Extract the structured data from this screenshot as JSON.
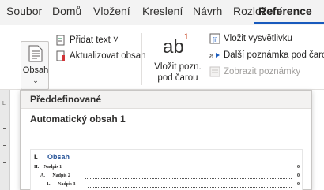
{
  "tabs": [
    "Soubor",
    "Domů",
    "Vložení",
    "Kreslení",
    "Návrh",
    "Rozložení",
    "Reference"
  ],
  "active_tab": "Reference",
  "ribbon": {
    "obsah_label": "Obsah",
    "obsah_chevron": "⌄",
    "pridat_text": "Přidat text ˅",
    "aktualizovat": "Aktualizovat obsah",
    "ab_label": "ab",
    "ab_sup": "1",
    "vlozit_pozn_line1": "Vložit pozn.",
    "vlozit_pozn_line2": "pod čarou",
    "vlozit_vysvetlivku": "Vložit vysvětlivku",
    "dalsi_poznamka": "Další poznámka pod čarou",
    "zobrazit_poznamky": "Zobrazit poznámky"
  },
  "gallery": {
    "section_title": "Předdefinované",
    "item_title": "Automatický obsah 1",
    "preview": {
      "heading_num": "I.",
      "heading": "Obsah",
      "lines": [
        {
          "num": "II.",
          "text": "Nadpis 1",
          "page": "0"
        },
        {
          "num": "A.",
          "text": "Nadpis 2",
          "page": "0"
        },
        {
          "num": "1.",
          "text": "Nadpis 3",
          "page": "0"
        }
      ]
    }
  }
}
